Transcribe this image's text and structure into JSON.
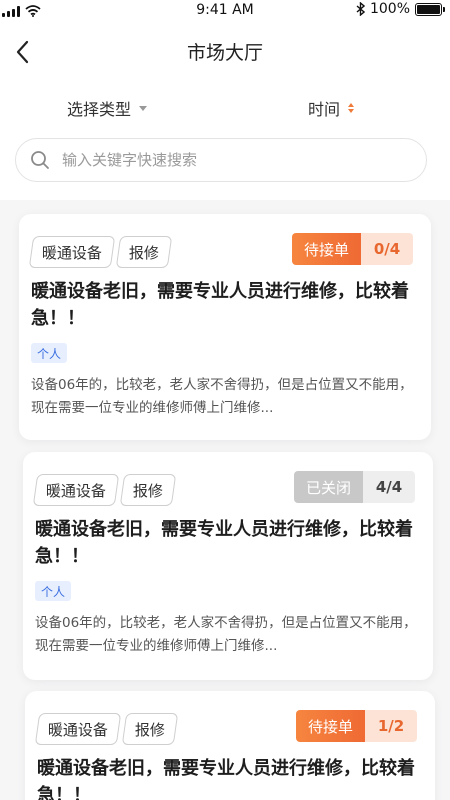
{
  "status_bar": {
    "time": "9:41 AM",
    "battery_label": "100%",
    "battery_level": 1.0
  },
  "header": {
    "title": "市场大厅"
  },
  "filters": {
    "type_label": "选择类型",
    "time_label": "时间"
  },
  "search": {
    "placeholder": "输入关键字快速搜索"
  },
  "colors": {
    "accent": "#f07a3a",
    "closed_gray": "#c8c8c8",
    "badge_blue": "#3c6fe0"
  },
  "cards": [
    {
      "tags": [
        "暖通设备",
        "报修"
      ],
      "status": "待接单",
      "count": "0/4",
      "title": "暖通设备老旧，需要专业人员进行维修，比较着急！！",
      "owner": "个人",
      "description": "设备06年的，比较老，老人家不舍得扔，但是占位置又不能用，现在需要一位专业的维修师傅上门维修..."
    },
    {
      "tags": [
        "暖通设备",
        "报修"
      ],
      "status": "已关闭",
      "count": "4/4",
      "title": "暖通设备老旧，需要专业人员进行维修，比较着急！！",
      "owner": "个人",
      "description": "设备06年的，比较老，老人家不舍得扔，但是占位置又不能用，现在需要一位专业的维修师傅上门维修..."
    },
    {
      "tags": [
        "暖通设备",
        "报修"
      ],
      "status": "待接单",
      "count": "1/2",
      "title": "暖通设备老旧，需要专业人员进行维修，比较着急！！"
    }
  ]
}
